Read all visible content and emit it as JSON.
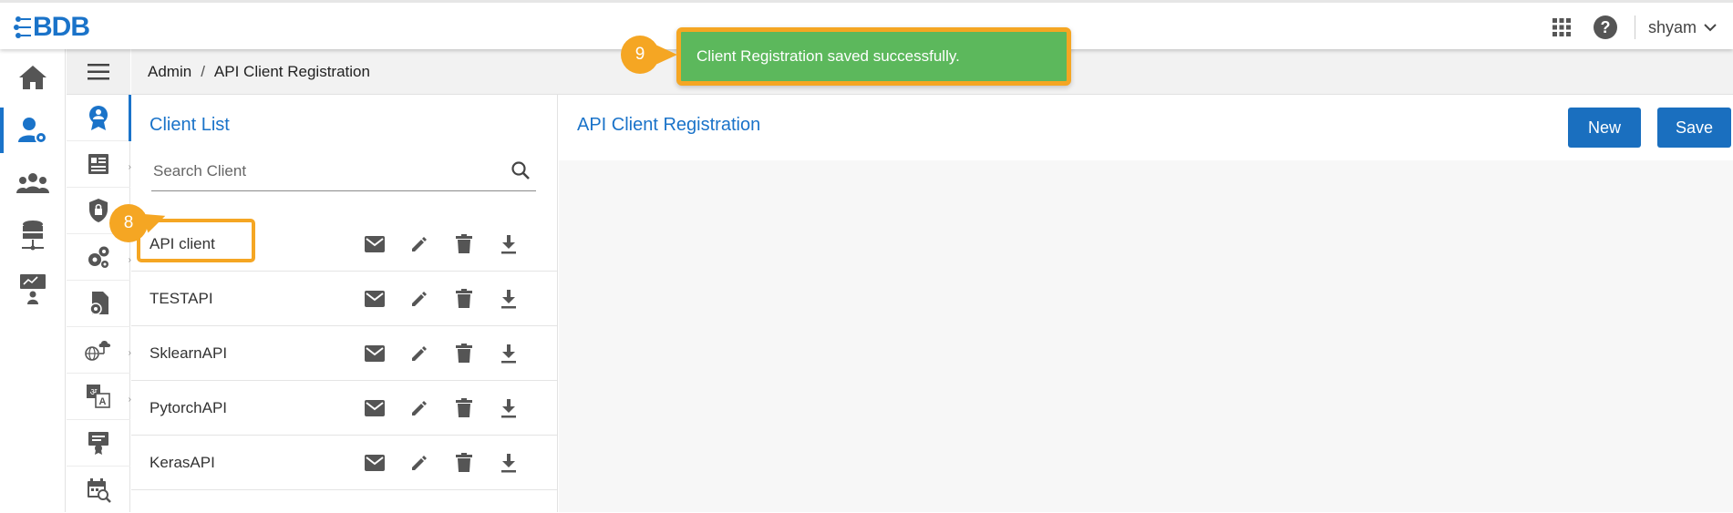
{
  "header": {
    "logo_text": "BDB",
    "user_name": "shyam"
  },
  "breadcrumb": {
    "root": "Admin",
    "separator": "/",
    "current": "API Client Registration"
  },
  "client_list": {
    "title": "Client List",
    "search_placeholder": "Search Client",
    "items": [
      {
        "name": "API client"
      },
      {
        "name": "TESTAPI"
      },
      {
        "name": "SklearnAPI"
      },
      {
        "name": "PytorchAPI"
      },
      {
        "name": "KerasAPI"
      }
    ]
  },
  "main": {
    "title": "API Client Registration",
    "new_label": "New",
    "save_label": "Save"
  },
  "toast": {
    "message": "Client Registration saved successfully."
  },
  "annotations": {
    "step_8": "8",
    "step_9": "9"
  },
  "colors": {
    "accent": "#1a73c9",
    "button": "#1a6fbf",
    "success": "#5cb85c",
    "highlight": "#f5a623"
  }
}
